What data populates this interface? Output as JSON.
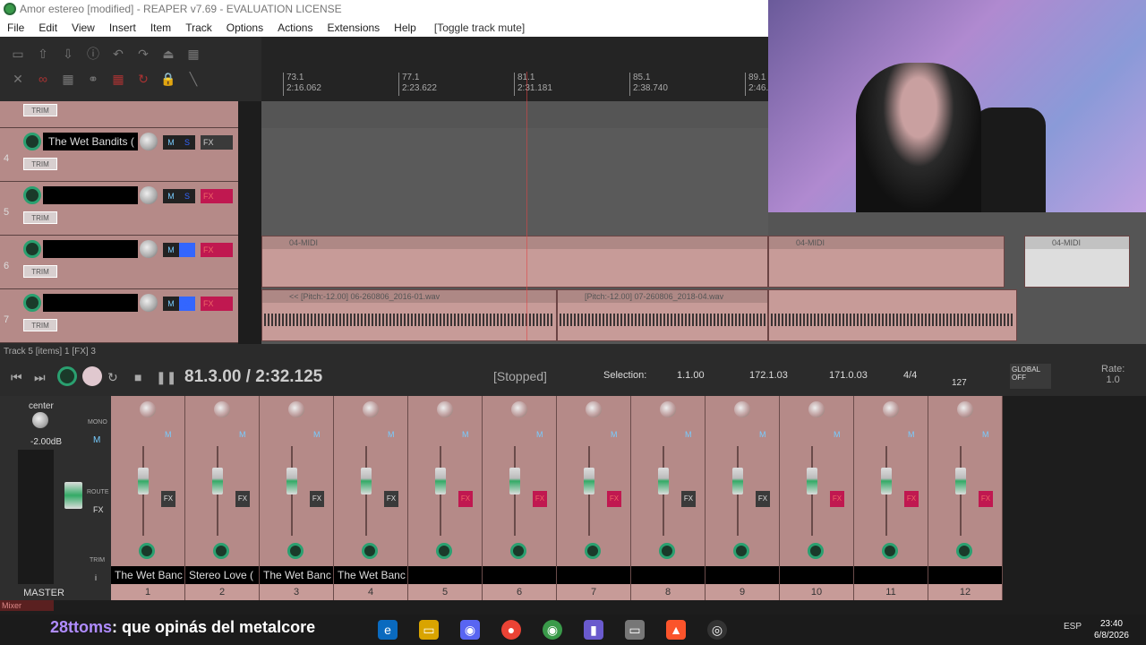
{
  "window": {
    "title": "Amor estereo [modified] - REAPER v7.69 - EVALUATION LICENSE"
  },
  "menu": {
    "items": [
      "File",
      "Edit",
      "View",
      "Insert",
      "Item",
      "Track",
      "Options",
      "Actions",
      "Extensions",
      "Help"
    ],
    "hint": "[Toggle track mute]"
  },
  "ruler": {
    "marks": [
      {
        "bar": "73.1",
        "time": "2:16.062"
      },
      {
        "bar": "77.1",
        "time": "2:23.622"
      },
      {
        "bar": "81.1",
        "time": "2:31.181"
      },
      {
        "bar": "85.1",
        "time": "2:38.740"
      },
      {
        "bar": "89.1",
        "time": "2:46."
      }
    ]
  },
  "tracks": [
    {
      "num": "4",
      "name": "The Wet Bandits (",
      "fx": "FX",
      "trim": "TRIM"
    },
    {
      "num": "5",
      "name": "",
      "fx": "FX",
      "trim": "TRIM"
    },
    {
      "num": "6",
      "name": "",
      "fx": "FX",
      "trim": "TRIM"
    },
    {
      "num": "7",
      "name": "",
      "fx": "FX",
      "trim": "TRIM"
    }
  ],
  "items": {
    "midi": "04-MIDI",
    "wav1": "<< [Pitch:-12.00] 06-260806_2016-01.wav",
    "wav2": "[Pitch:-12.00] 07-260806_2018-04.wav"
  },
  "status": {
    "text": "Track 5 [items] 1 [FX] 3"
  },
  "transport": {
    "position": "81.3.00 / 2:32.125",
    "state": "[Stopped]",
    "selection_label": "Selection:",
    "sel_start": "1.1.00",
    "sel_end": "172.1.03",
    "sel_length": "171.0.03",
    "time_sig": "4/4",
    "bpm": "127",
    "global": "GLOBAL",
    "global_state": "OFF",
    "rate_label": "Rate:",
    "rate": "1.0"
  },
  "master": {
    "pan": "center",
    "volume": "-2.00dB",
    "label": "MASTER",
    "mono": "MONO",
    "route": "ROUTE",
    "fx": "FX",
    "trim": "TRIM",
    "m": "M",
    "info": "i"
  },
  "mixer": {
    "strips": [
      {
        "num": "1",
        "name": "The Wet Banc"
      },
      {
        "num": "2",
        "name": "Stereo Love ("
      },
      {
        "num": "3",
        "name": "The Wet Banc"
      },
      {
        "num": "4",
        "name": "The Wet Banc"
      },
      {
        "num": "5",
        "name": ""
      },
      {
        "num": "6",
        "name": ""
      },
      {
        "num": "7",
        "name": ""
      },
      {
        "num": "8",
        "name": ""
      },
      {
        "num": "9",
        "name": ""
      },
      {
        "num": "10",
        "name": ""
      },
      {
        "num": "11",
        "name": ""
      },
      {
        "num": "12",
        "name": ""
      }
    ],
    "label": "Mixer"
  },
  "chat": {
    "user": "28ttoms",
    "message": ": que opinás del metalcore"
  },
  "clock": {
    "time": "23:40",
    "date": "6/8/2026",
    "lang": "ESP"
  },
  "colors": {
    "track": "#b58a88",
    "accent": "#2aa070",
    "fx_active": "#c01850"
  }
}
